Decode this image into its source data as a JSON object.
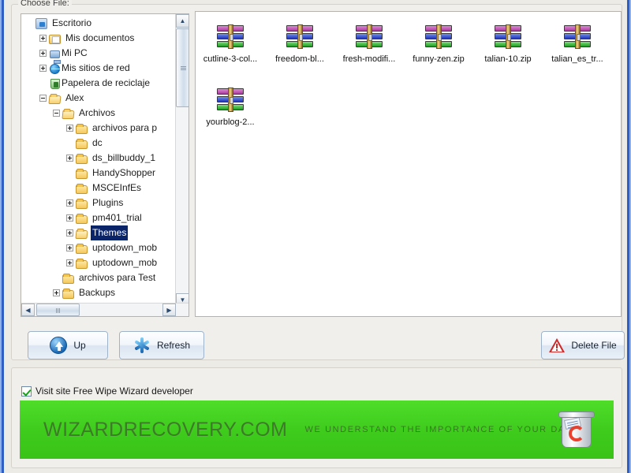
{
  "window": {
    "group_top_legend": "Choose File:",
    "border_color": "#2f5fc4"
  },
  "tree": {
    "nodes": [
      {
        "label": "Escritorio",
        "indent": 0,
        "expander": "none",
        "icon": "desktop-icon",
        "selected": false
      },
      {
        "label": "Mis documentos",
        "indent": 1,
        "expander": "plus",
        "icon": "documents-icon",
        "selected": false
      },
      {
        "label": "Mi PC",
        "indent": 1,
        "expander": "plus",
        "icon": "computer-icon",
        "selected": false
      },
      {
        "label": "Mis sitios de red",
        "indent": 1,
        "expander": "plus",
        "icon": "network-icon",
        "selected": false
      },
      {
        "label": "Papelera de reciclaje",
        "indent": 1,
        "expander": "none",
        "icon": "recycle-bin-icon",
        "selected": false
      },
      {
        "label": "Alex",
        "indent": 1,
        "expander": "minus",
        "icon": "folder-open-icon",
        "selected": false
      },
      {
        "label": "Archivos",
        "indent": 2,
        "expander": "minus",
        "icon": "folder-open-icon",
        "selected": false
      },
      {
        "label": "archivos para p",
        "indent": 3,
        "expander": "plus",
        "icon": "folder-icon",
        "selected": false
      },
      {
        "label": "dc",
        "indent": 3,
        "expander": "none",
        "icon": "folder-icon",
        "selected": false
      },
      {
        "label": "ds_billbuddy_1",
        "indent": 3,
        "expander": "plus",
        "icon": "folder-icon",
        "selected": false
      },
      {
        "label": "HandyShopper",
        "indent": 3,
        "expander": "none",
        "icon": "folder-icon",
        "selected": false
      },
      {
        "label": "MSCEInfEs",
        "indent": 3,
        "expander": "none",
        "icon": "folder-icon",
        "selected": false
      },
      {
        "label": "Plugins",
        "indent": 3,
        "expander": "plus",
        "icon": "folder-icon",
        "selected": false
      },
      {
        "label": "pm401_trial",
        "indent": 3,
        "expander": "plus",
        "icon": "folder-icon",
        "selected": false
      },
      {
        "label": "Themes",
        "indent": 3,
        "expander": "plus",
        "icon": "folder-open-icon",
        "selected": true
      },
      {
        "label": "uptodown_mob",
        "indent": 3,
        "expander": "plus",
        "icon": "folder-icon",
        "selected": false
      },
      {
        "label": "uptodown_mob",
        "indent": 3,
        "expander": "plus",
        "icon": "folder-icon",
        "selected": false
      },
      {
        "label": "archivos para Test",
        "indent": 2,
        "expander": "none",
        "icon": "folder-icon",
        "selected": false
      },
      {
        "label": "Backups",
        "indent": 2,
        "expander": "plus",
        "icon": "folder-icon",
        "selected": false
      }
    ],
    "vscroll": {
      "up_glyph": "▲",
      "down_glyph": "▼"
    },
    "hscroll": {
      "left_glyph": "◀",
      "right_glyph": "▶"
    }
  },
  "files": {
    "items": [
      {
        "name": "cutline-3-col...",
        "icon": "archive-icon"
      },
      {
        "name": "freedom-bl...",
        "icon": "archive-icon"
      },
      {
        "name": "fresh-modifi...",
        "icon": "archive-icon"
      },
      {
        "name": "funny-zen.zip",
        "icon": "archive-icon"
      },
      {
        "name": "talian-10.zip",
        "icon": "archive-icon"
      },
      {
        "name": "talian_es_tr...",
        "icon": "archive-icon"
      },
      {
        "name": "yourblog-2...",
        "icon": "archive-icon"
      }
    ]
  },
  "toolbar": {
    "up_label": "Up",
    "refresh_label": "Refresh",
    "delete_label": "Delete File"
  },
  "footer": {
    "checkbox_label": "Visit site Free Wipe Wizard developer",
    "checkbox_checked": true,
    "banner": {
      "brand": "WIZARDRECOVERY.COM",
      "tagline": "WE UNDERSTAND THE IMPORTANCE OF YOUR DATA",
      "background_color": "#3fcc1d",
      "text_color": "#3d7a29",
      "icon": "recycle-bin-icon"
    }
  }
}
